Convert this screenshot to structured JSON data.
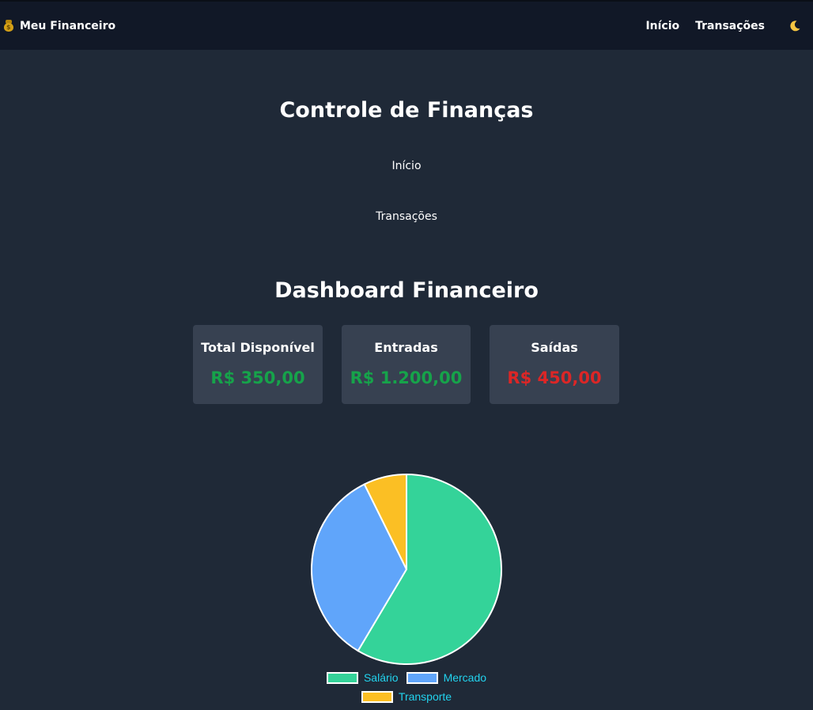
{
  "navbar": {
    "brand": "Meu Financeiro",
    "links": [
      "Início",
      "Transações"
    ],
    "theme_icon": "moon-icon"
  },
  "main": {
    "title": "Controle de Finanças",
    "menu": [
      "Início",
      "Transações"
    ],
    "dashboard_title": "Dashboard Financeiro"
  },
  "cards": [
    {
      "label": "Total Disponível",
      "value": "R$ 350,00",
      "color": "#16a34a"
    },
    {
      "label": "Entradas",
      "value": "R$ 1.200,00",
      "color": "#16a34a"
    },
    {
      "label": "Saídas",
      "value": "R$ 450,00",
      "color": "#dc2626"
    }
  ],
  "chart_data": {
    "type": "pie",
    "categories": [
      "Salário",
      "Mercado",
      "Transporte"
    ],
    "values": [
      1200,
      700,
      150
    ],
    "colors": [
      "#34d399",
      "#60a5fa",
      "#fbbf24"
    ],
    "legend_color": "#22d3ee",
    "legend_position": "bottom"
  }
}
